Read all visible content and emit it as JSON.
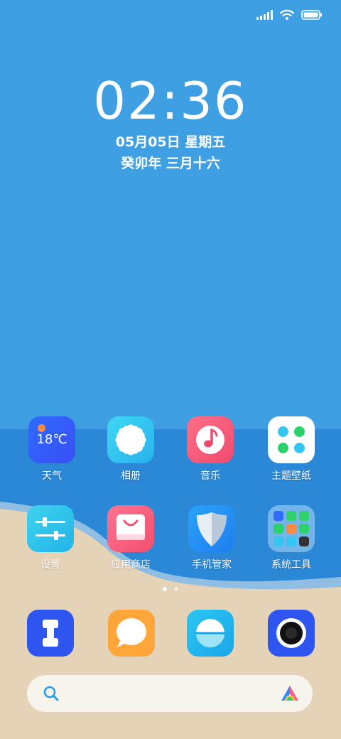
{
  "status_bar": {
    "signal_icon": "signal-icon",
    "wifi_icon": "wifi-icon",
    "battery_icon": "battery-icon"
  },
  "lockinfo": {
    "time": "02:36",
    "date": "05月05日 星期五",
    "lunar": "癸卯年 三月十六"
  },
  "apps": [
    {
      "label": "天气",
      "icon": "weather-icon",
      "temp": "18℃"
    },
    {
      "label": "相册",
      "icon": "gallery-icon"
    },
    {
      "label": "音乐",
      "icon": "music-icon"
    },
    {
      "label": "主题壁纸",
      "icon": "themes-icon"
    },
    {
      "label": "设置",
      "icon": "settings-icon"
    },
    {
      "label": "应用商店",
      "icon": "app-store-icon"
    },
    {
      "label": "手机管家",
      "icon": "security-icon"
    },
    {
      "label": "系统工具",
      "icon": "folder-icon"
    }
  ],
  "page_indicator": {
    "pages": 2,
    "active": 1
  },
  "dock": [
    {
      "icon": "phone-icon"
    },
    {
      "icon": "messages-icon"
    },
    {
      "icon": "browser-icon"
    },
    {
      "icon": "camera-icon"
    }
  ],
  "search": {
    "icon": "search-icon",
    "assistant_icon": "assistant-icon"
  },
  "colors": {
    "sky": "#3e9fe2",
    "sea": "#2f8ad6",
    "sand": "#e5d3b8"
  }
}
